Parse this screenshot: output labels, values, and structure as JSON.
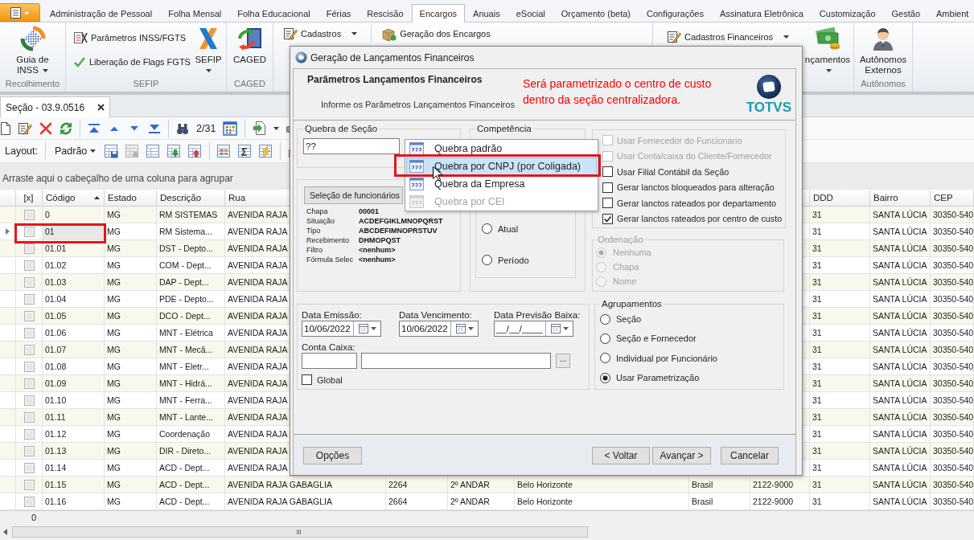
{
  "ribbon": {
    "tabs": [
      {
        "label": "Administração de Pessoal",
        "selected": false
      },
      {
        "label": "Folha Mensal",
        "selected": false
      },
      {
        "label": "Folha Educacional",
        "selected": false
      },
      {
        "label": "Férias",
        "selected": false
      },
      {
        "label": "Rescisão",
        "selected": false
      },
      {
        "label": "Encargos",
        "selected": true
      },
      {
        "label": "Anuais",
        "selected": false
      },
      {
        "label": "eSocial",
        "selected": false
      },
      {
        "label": "Orçamento (beta)",
        "selected": false
      },
      {
        "label": "Configurações",
        "selected": false
      },
      {
        "label": "Assinatura Eletrônica",
        "selected": false
      },
      {
        "label": "Customização",
        "selected": false
      },
      {
        "label": "Gestão",
        "selected": false
      },
      {
        "label": "Ambient",
        "selected": false
      }
    ],
    "groups": [
      {
        "label": "Recolhimento",
        "buttons": [
          {
            "kind": "large",
            "label": "Guia de INSS",
            "dropdown": true
          }
        ]
      },
      {
        "label": "SEFIP",
        "buttons": [
          {
            "kind": "small",
            "label": "Parâmetros INSS/FGTS",
            "dropdown": false
          },
          {
            "kind": "small",
            "label": "Liberação de Flags FGTS",
            "dropdown": false
          },
          {
            "kind": "large",
            "label": "SEFIP",
            "dropdown": true
          }
        ]
      },
      {
        "label": "CAGED",
        "buttons": [
          {
            "kind": "large",
            "label": "CAGED",
            "dropdown": false
          }
        ]
      },
      {
        "buttons": [
          {
            "kind": "small",
            "label": "Cadastros",
            "dropdown": true
          },
          {
            "kind": "small",
            "label": "Geração dos Encargos",
            "dropdown": false
          }
        ]
      },
      {
        "buttons": [
          {
            "kind": "small",
            "label": "Cadastros Financeiros",
            "dropdown": true
          },
          {
            "kind": "large",
            "label": "nçamentos",
            "dropdown": true
          }
        ]
      },
      {
        "label": "Autônomos",
        "buttons": [
          {
            "kind": "large",
            "label": "Autônomos Externos",
            "dropdown": false
          }
        ]
      }
    ]
  },
  "document_tab": {
    "title": "Seção - 03.9.0516"
  },
  "toolbar": {
    "record_position": "2/31",
    "layout_label": "Layout:",
    "layout_value": "Padrão"
  },
  "grid": {
    "group_hint": "Arraste aqui o cabeçalho de uma coluna para agrupar",
    "headers": {
      "checked": {
        "label": "[x]",
        "sorted": false
      },
      "code": {
        "label": "Código",
        "sorted": true
      },
      "state": {
        "label": "Estado",
        "sorted": false
      },
      "description": {
        "label": "Descrição",
        "sorted": false
      },
      "street": {
        "label": "Rua",
        "sorted": false
      },
      "ddd": {
        "label": "DDD",
        "sorted": false
      },
      "district": {
        "label": "Bairro",
        "sorted": false
      },
      "zip": {
        "label": "CEP",
        "sorted": false
      }
    },
    "rows": [
      {
        "checked": false,
        "code": "0",
        "state": "MG",
        "description": "RM SISTEMAS",
        "street": "AVENIDA RAJA",
        "ddd": "31",
        "district": "SANTA LÚCIA",
        "zip": "30350-540",
        "selected": false,
        "framed": false
      },
      {
        "checked": false,
        "code": "01",
        "state": "MG",
        "description": "RM Sistema...",
        "street": "AVENIDA RAJA",
        "ddd": "31",
        "district": "SANTA LÚCIA",
        "zip": "30350-540",
        "selected": true,
        "framed": true
      },
      {
        "checked": false,
        "code": "01.01",
        "state": "MG",
        "description": "DST - Depto...",
        "street": "AVENIDA RAJA",
        "ddd": "31",
        "district": "SANTA LÚCIA",
        "zip": "30350-540",
        "selected": false,
        "framed": false
      },
      {
        "checked": false,
        "code": "01.02",
        "state": "MG",
        "description": "COM - Dept...",
        "street": "AVENIDA RAJA",
        "ddd": "31",
        "district": "SANTA LÚCIA",
        "zip": "30350-540",
        "selected": false,
        "framed": false
      },
      {
        "checked": false,
        "code": "01.03",
        "state": "MG",
        "description": "DAP - Dept...",
        "street": "AVENIDA RAJA",
        "ddd": "31",
        "district": "SANTA LÚCIA",
        "zip": "30350-540",
        "selected": false,
        "framed": false
      },
      {
        "checked": false,
        "code": "01.04",
        "state": "MG",
        "description": "PDE - Depto...",
        "street": "AVENIDA RAJA",
        "ddd": "31",
        "district": "SANTA LÚCIA",
        "zip": "30350-540",
        "selected": false,
        "framed": false
      },
      {
        "checked": false,
        "code": "01.05",
        "state": "MG",
        "description": "DCO - Dept...",
        "street": "AVENIDA RAJA",
        "ddd": "31",
        "district": "SANTA LÚCIA",
        "zip": "30350-540",
        "selected": false,
        "framed": false
      },
      {
        "checked": false,
        "code": "01.06",
        "state": "MG",
        "description": "MNT - Elétrica",
        "street": "AVENIDA RAJA",
        "ddd": "31",
        "district": "SANTA LÚCIA",
        "zip": "30350-540",
        "selected": false,
        "framed": false
      },
      {
        "checked": false,
        "code": "01.07",
        "state": "MG",
        "description": "MNT - Mecâ...",
        "street": "AVENIDA RAJA",
        "ddd": "31",
        "district": "SANTA LÚCIA",
        "zip": "30350-540",
        "selected": false,
        "framed": false
      },
      {
        "checked": false,
        "code": "01.08",
        "state": "MG",
        "description": "MNT - Eletr...",
        "street": "AVENIDA RAJA",
        "ddd": "31",
        "district": "SANTA LÚCIA",
        "zip": "30350-540",
        "selected": false,
        "framed": false
      },
      {
        "checked": false,
        "code": "01.09",
        "state": "MG",
        "description": "MNT - Hidrá...",
        "street": "AVENIDA RAJA",
        "ddd": "31",
        "district": "SANTA LÚCIA",
        "zip": "30350-540",
        "selected": false,
        "framed": false
      },
      {
        "checked": false,
        "code": "01.10",
        "state": "MG",
        "description": "MNT - Ferra...",
        "street": "AVENIDA RAJA",
        "ddd": "31",
        "district": "SANTA LÚCIA",
        "zip": "30350-540",
        "selected": false,
        "framed": false
      },
      {
        "checked": false,
        "code": "01.11",
        "state": "MG",
        "description": "MNT - Lante...",
        "street": "AVENIDA RAJA",
        "ddd": "31",
        "district": "SANTA LÚCIA",
        "zip": "30350-540",
        "selected": false,
        "framed": false
      },
      {
        "checked": false,
        "code": "01.12",
        "state": "MG",
        "description": "Coordenação",
        "street": "AVENIDA RAJA",
        "ddd": "31",
        "district": "SANTA LÚCIA",
        "zip": "30350-540",
        "selected": false,
        "framed": false
      },
      {
        "checked": false,
        "code": "01.13",
        "state": "MG",
        "description": "DIR - Direto...",
        "street": "AVENIDA RAJA",
        "ddd": "31",
        "district": "SANTA LÚCIA",
        "zip": "30350-540",
        "selected": false,
        "framed": false
      },
      {
        "checked": false,
        "code": "01.14",
        "state": "MG",
        "description": "ACD - Dept...",
        "street": "AVENIDA RAJA",
        "ddd": "31",
        "district": "SANTA LÚCIA",
        "zip": "30350-540",
        "selected": false,
        "framed": false
      },
      {
        "checked": false,
        "code": "01.15",
        "state": "MG",
        "description": "ACD - Dept...",
        "street": "AVENIDA RAJA GABAGLIA",
        "column_6": "2264",
        "column_7": "2º ANDAR",
        "column_8": "Belo Horizonte",
        "column_9": "Brasil",
        "column_10": "2122-9000",
        "ddd": "31",
        "district": "SANTA LÚCIA",
        "zip": "30350-540",
        "selected": false,
        "framed": false
      },
      {
        "checked": false,
        "code": "01.16",
        "state": "MG",
        "description": "ACD - Dept...",
        "street": "AVENIDA RAJA GABAGLIA",
        "column_6": "2664",
        "column_7": "2º ANDAR",
        "column_8": "Belo Horizonte",
        "column_9": "Brasil",
        "column_10": "2122-9000",
        "ddd": "31",
        "district": "SANTA LÚCIA",
        "zip": "30350-540",
        "selected": false,
        "framed": false
      }
    ],
    "summary": "0"
  },
  "dialog": {
    "title": "Geração de Lançamentos Financeiros",
    "heading": "Parâmetros Lançamentos Financeiros",
    "subheading": "Informe os Parâmetros Lançamentos Financeiros",
    "note": "Será parametrizado o centro de custo dentro da seção centralizadora.",
    "logo": "TOTVS",
    "section_break": {
      "title": "Quebra de Seção",
      "value": "??"
    },
    "selection": {
      "button": "Seleção de funcionários",
      "fields": [
        {
          "label": "Chapa",
          "value": "00001"
        },
        {
          "label": "Situação",
          "value": "ACDEFGIKLMNOPQRST"
        },
        {
          "label": "Tipo",
          "value": "ABCDEFIMNOPRSTUV"
        },
        {
          "label": "Recebimento",
          "value": "DHMOPQST"
        },
        {
          "label": "Filtro",
          "value": "<nenhum>"
        },
        {
          "label": "Fórmula Selec",
          "value": "<nenhum>"
        }
      ]
    },
    "competence": {
      "title": "Competência",
      "options": [
        {
          "label": "Atual",
          "selected": false
        },
        {
          "label": "Período",
          "selected": false
        }
      ]
    },
    "options": [
      {
        "label": "Usar Fornecedor do Funcionário",
        "checked": false,
        "disabled": true
      },
      {
        "label": "Usar Conta/caixa do Cliente/Fornecedor",
        "checked": false,
        "disabled": true
      },
      {
        "label": "Usar Filial Contábil da Seção",
        "checked": false,
        "disabled": false
      },
      {
        "label": "Gerar lanctos bloqueados para alteração",
        "checked": false,
        "disabled": false
      },
      {
        "label": "Gerar lanctos rateados por departamento",
        "checked": false,
        "disabled": false
      },
      {
        "label": "Gerar lanctos rateados por centro de custo",
        "checked": true,
        "disabled": false
      }
    ],
    "ordering": {
      "title": "Ordenação",
      "disabled": true,
      "options": [
        {
          "label": "Nenhuma",
          "selected": true
        },
        {
          "label": "Chapa",
          "selected": false
        },
        {
          "label": "Nome",
          "selected": false
        }
      ]
    },
    "dates": [
      {
        "label": "Data Emissão:",
        "value": "10/06/2022"
      },
      {
        "label": "Data Vencimento:",
        "value": "10/06/2022"
      },
      {
        "label": "Data Previsão Baixa:",
        "value": "__/__/____"
      }
    ],
    "cash_account": {
      "label": "Conta Caixa:",
      "browse": "..."
    },
    "global": {
      "label": "Global",
      "checked": false
    },
    "grouping": {
      "title": "Agrupamentos",
      "options": [
        {
          "label": "Seção",
          "selected": false
        },
        {
          "label": "Seção e Fornecedor",
          "selected": false
        },
        {
          "label": "Individual por Funcionário",
          "selected": false
        },
        {
          "label": "Usar Parametrização",
          "selected": true
        }
      ]
    },
    "buttons": [
      "Opções",
      "< Voltar",
      "Avançar >",
      "Cancelar"
    ],
    "dropdown": {
      "items": [
        {
          "label": "Quebra padrão",
          "selected": false,
          "disabled": false,
          "framed": false
        },
        {
          "label": "Quebra por CNPJ (por Coligada)",
          "selected": true,
          "disabled": false,
          "framed": true
        },
        {
          "label": "Quebra da Empresa",
          "selected": false,
          "disabled": false,
          "framed": false
        },
        {
          "label": "Quebra por CEI",
          "selected": false,
          "disabled": true,
          "framed": false
        }
      ]
    }
  }
}
